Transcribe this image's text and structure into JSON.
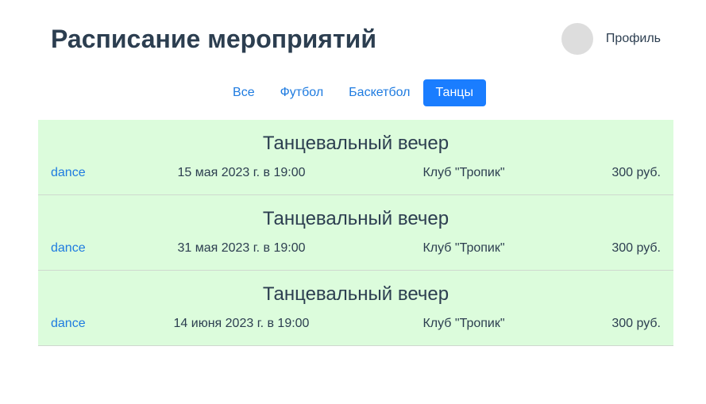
{
  "header": {
    "title": "Расписание мероприятий",
    "profile_label": "Профиль"
  },
  "filters": [
    {
      "label": "Все",
      "active": false
    },
    {
      "label": "Футбол",
      "active": false
    },
    {
      "label": "Баскетбол",
      "active": false
    },
    {
      "label": "Танцы",
      "active": true
    }
  ],
  "events": [
    {
      "title": "Танцевальный вечер",
      "tag": "dance",
      "date": "15 мая 2023 г. в 19:00",
      "place": "Клуб \"Тропик\"",
      "price": "300 руб."
    },
    {
      "title": "Танцевальный вечер",
      "tag": "dance",
      "date": "31 мая 2023 г. в 19:00",
      "place": "Клуб \"Тропик\"",
      "price": "300 руб."
    },
    {
      "title": "Танцевальный вечер",
      "tag": "dance",
      "date": "14 июня 2023 г. в 19:00",
      "place": "Клуб \"Тропик\"",
      "price": "300 руб."
    }
  ],
  "colors": {
    "accent": "#1a7dff",
    "link": "#1e7be0",
    "event_bg": "#dcfcdc",
    "text": "#2c3e50",
    "avatar": "#dddddd"
  },
  "icons": {
    "avatar": "avatar-circle"
  }
}
